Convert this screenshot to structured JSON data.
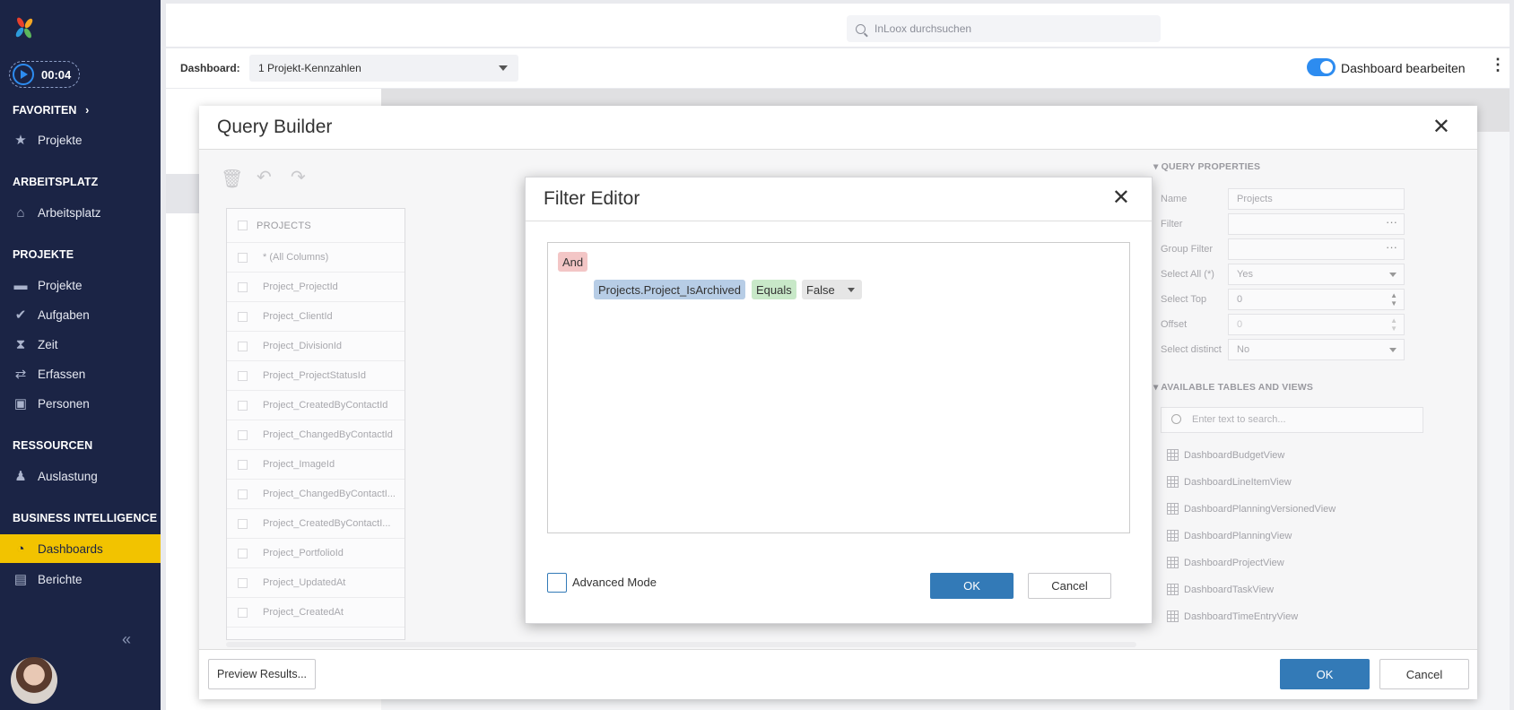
{
  "sidebar": {
    "timer": "00:04",
    "sections": {
      "favoriten": "FAVORITEN",
      "arbeitsplatz": "ARBEITSPLATZ",
      "projekte": "PROJEKTE",
      "ressourcen": "RESSOURCEN",
      "bi": "BUSINESS INTELLIGENCE"
    },
    "items": {
      "fav_projekte": "Projekte",
      "arbeitsplatz": "Arbeitsplatz",
      "projekte": "Projekte",
      "aufgaben": "Aufgaben",
      "zeit": "Zeit",
      "erfassen": "Erfassen",
      "personen": "Personen",
      "auslastung": "Auslastung",
      "dashboards": "Dashboards",
      "berichte": "Berichte"
    },
    "active_color": "#f2c300"
  },
  "top": {
    "search_placeholder": "InLoox durchsuchen"
  },
  "dashbar": {
    "label": "Dashboard:",
    "selected": "1 Projekt-Kennzahlen",
    "edit_label": "Dashboard bearbeiten",
    "edit_enabled": true
  },
  "query_builder": {
    "title": "Query Builder",
    "table": {
      "name": "PROJECTS",
      "columns": [
        "* (All Columns)",
        "Project_ProjectId",
        "Project_ClientId",
        "Project_DivisionId",
        "Project_ProjectStatusId",
        "Project_CreatedByContactId",
        "Project_ChangedByContactId",
        "Project_ImageId",
        "Project_ChangedByContactI...",
        "Project_CreatedByContactI...",
        "Project_PortfolioId",
        "Project_UpdatedAt",
        "Project_CreatedAt"
      ]
    },
    "properties": {
      "header": "QUERY PROPERTIES",
      "name_label": "Name",
      "name_value": "Projects",
      "filter_label": "Filter",
      "group_filter_label": "Group Filter",
      "select_all_label": "Select All (*)",
      "select_all_value": "Yes",
      "select_top_label": "Select Top",
      "select_top_value": "0",
      "offset_label": "Offset",
      "offset_value": "0",
      "select_distinct_label": "Select distinct",
      "select_distinct_value": "No"
    },
    "available": {
      "header": "AVAILABLE TABLES AND VIEWS",
      "search_placeholder": "Enter text to search...",
      "items": [
        "DashboardBudgetView",
        "DashboardLineItemView",
        "DashboardPlanningVersionedView",
        "DashboardPlanningView",
        "DashboardProjectView",
        "DashboardTaskView",
        "DashboardTimeEntryView"
      ]
    },
    "footer": {
      "preview": "Preview Results...",
      "ok": "OK",
      "cancel": "Cancel"
    }
  },
  "filter_editor": {
    "title": "Filter Editor",
    "group_operator": "And",
    "condition": {
      "field": "Projects.Project_IsArchived",
      "operator": "Equals",
      "value": "False"
    },
    "advanced_mode_label": "Advanced Mode",
    "advanced_mode_checked": false,
    "ok": "OK",
    "cancel": "Cancel"
  }
}
